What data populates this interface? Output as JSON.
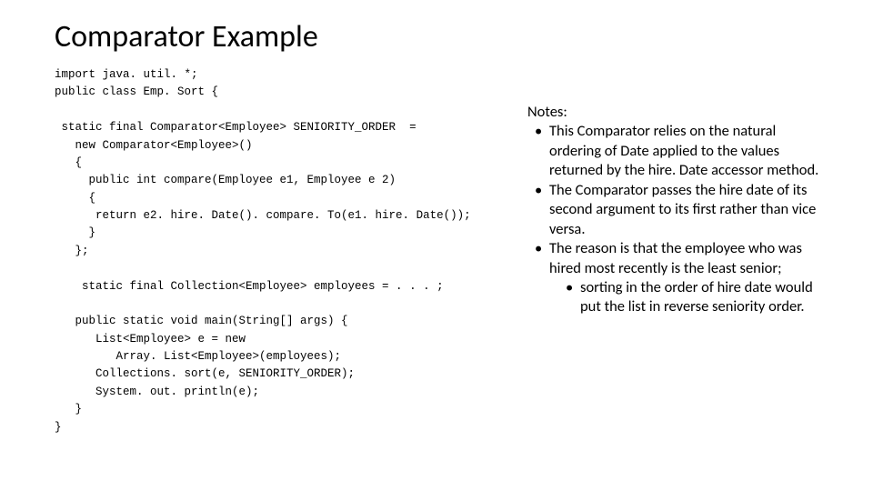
{
  "title": "Comparator Example",
  "code": {
    "l1": "import java. util. *;",
    "l2": "public class Emp. Sort {",
    "l3": " static final Comparator<Employee> SENIORITY_ORDER  =",
    "l4": "   new Comparator<Employee>()",
    "l5": "   {",
    "l6": "     public int compare(Employee e1, Employee e 2)",
    "l7": "     {",
    "l8": "      return e2. hire. Date(). compare. To(e1. hire. Date());",
    "l9": "     }",
    "l10": "   };",
    "l11": "    static final Collection<Employee> employees = . . . ;",
    "l12": "   public static void main(String[] args) {",
    "l13": "      List<Employee> e = new",
    "l14": "         Array. List<Employee>(employees);",
    "l15": "      Collections. sort(e, SENIORITY_ORDER);",
    "l16": "      System. out. println(e);",
    "l17": "   }",
    "l18": "}"
  },
  "notes": {
    "heading": "Notes:",
    "items": [
      "This Comparator relies on the natural ordering of Date applied to the values returned by the hire. Date accessor method.",
      "The Comparator passes the hire date of its second argument to its first rather than vice versa.",
      "The reason is that the employee who was hired most recently is the least senior;"
    ],
    "subitem": "sorting in the order of hire date would put the list in reverse seniority order."
  }
}
